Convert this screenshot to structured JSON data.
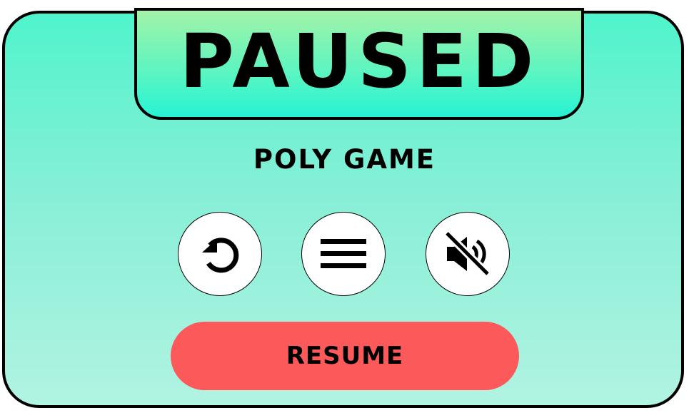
{
  "pause_dialog": {
    "title": "PAUSED",
    "game_name": "POLY GAME",
    "buttons": {
      "restart_icon": "restart-icon",
      "menu_icon": "menu-icon",
      "sound_icon": "muted-speaker-icon",
      "resume_label": "RESUME"
    }
  },
  "colors": {
    "panel_top": "#4ff4cc",
    "panel_bottom": "#b2f3e2",
    "title_tab_top": "#a2f3a8",
    "title_tab_bottom": "#26f2d4",
    "resume_button": "#fc5a5a",
    "icon_button": "#ffffff",
    "outline": "#000000"
  }
}
